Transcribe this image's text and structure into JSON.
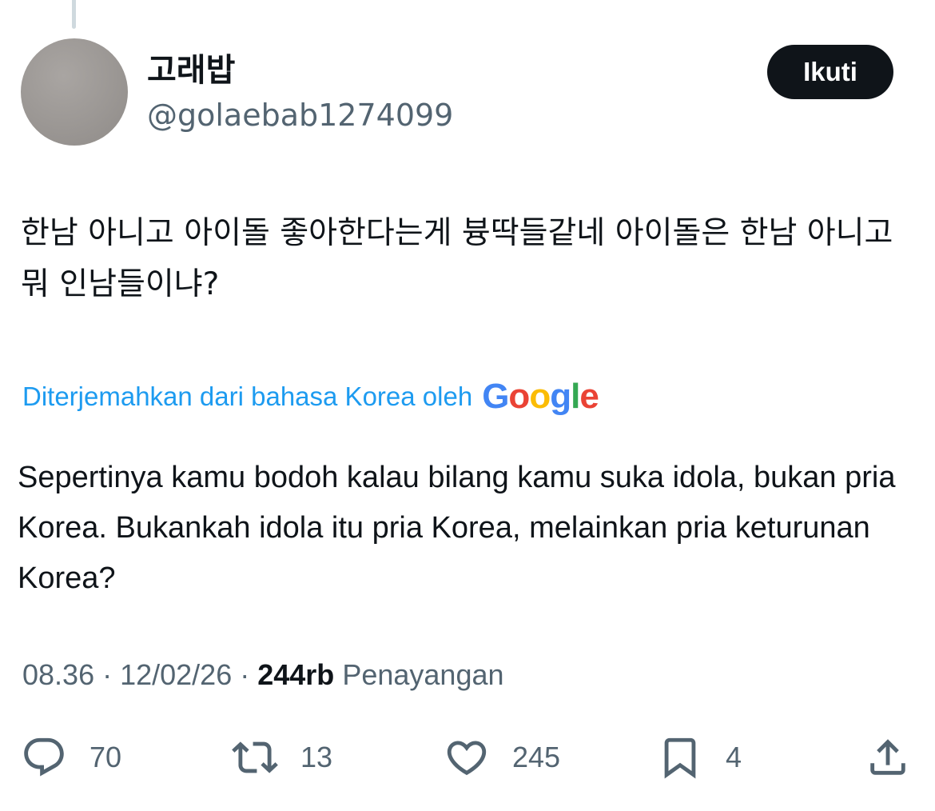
{
  "tweet": {
    "author": {
      "display_name": "고래밥",
      "handle": "@golaebab1274099"
    },
    "follow_label": "Ikuti",
    "original_text": "한남 아니고 아이돌 좋아한다는게 븅딱들같네 아이돌은 한남 아니고 뭐 인남들이냐?",
    "translation_label": "Diterjemahkan dari bahasa Korea oleh",
    "translation_provider": "Google",
    "translated_text": "Sepertinya kamu bodoh kalau bilang kamu suka idola, bukan pria Korea. Bukankah idola itu pria Korea, melainkan pria keturunan Korea?",
    "time": "08.36",
    "separator": "·",
    "date": "12/02/26",
    "views_count": "244rb",
    "views_label": "Penayangan"
  },
  "actions": {
    "reply": {
      "icon": "reply-icon",
      "count": "70"
    },
    "retweet": {
      "icon": "retweet-icon",
      "count": "13"
    },
    "like": {
      "icon": "heart-icon",
      "count": "245"
    },
    "bookmark": {
      "icon": "bookmark-icon",
      "count": "4"
    },
    "share": {
      "icon": "share-icon"
    }
  },
  "colors": {
    "text_primary": "#0f1419",
    "text_secondary": "#536471",
    "link_blue": "#1d9bf0",
    "button_bg": "#0f1419",
    "button_text": "#ffffff"
  }
}
